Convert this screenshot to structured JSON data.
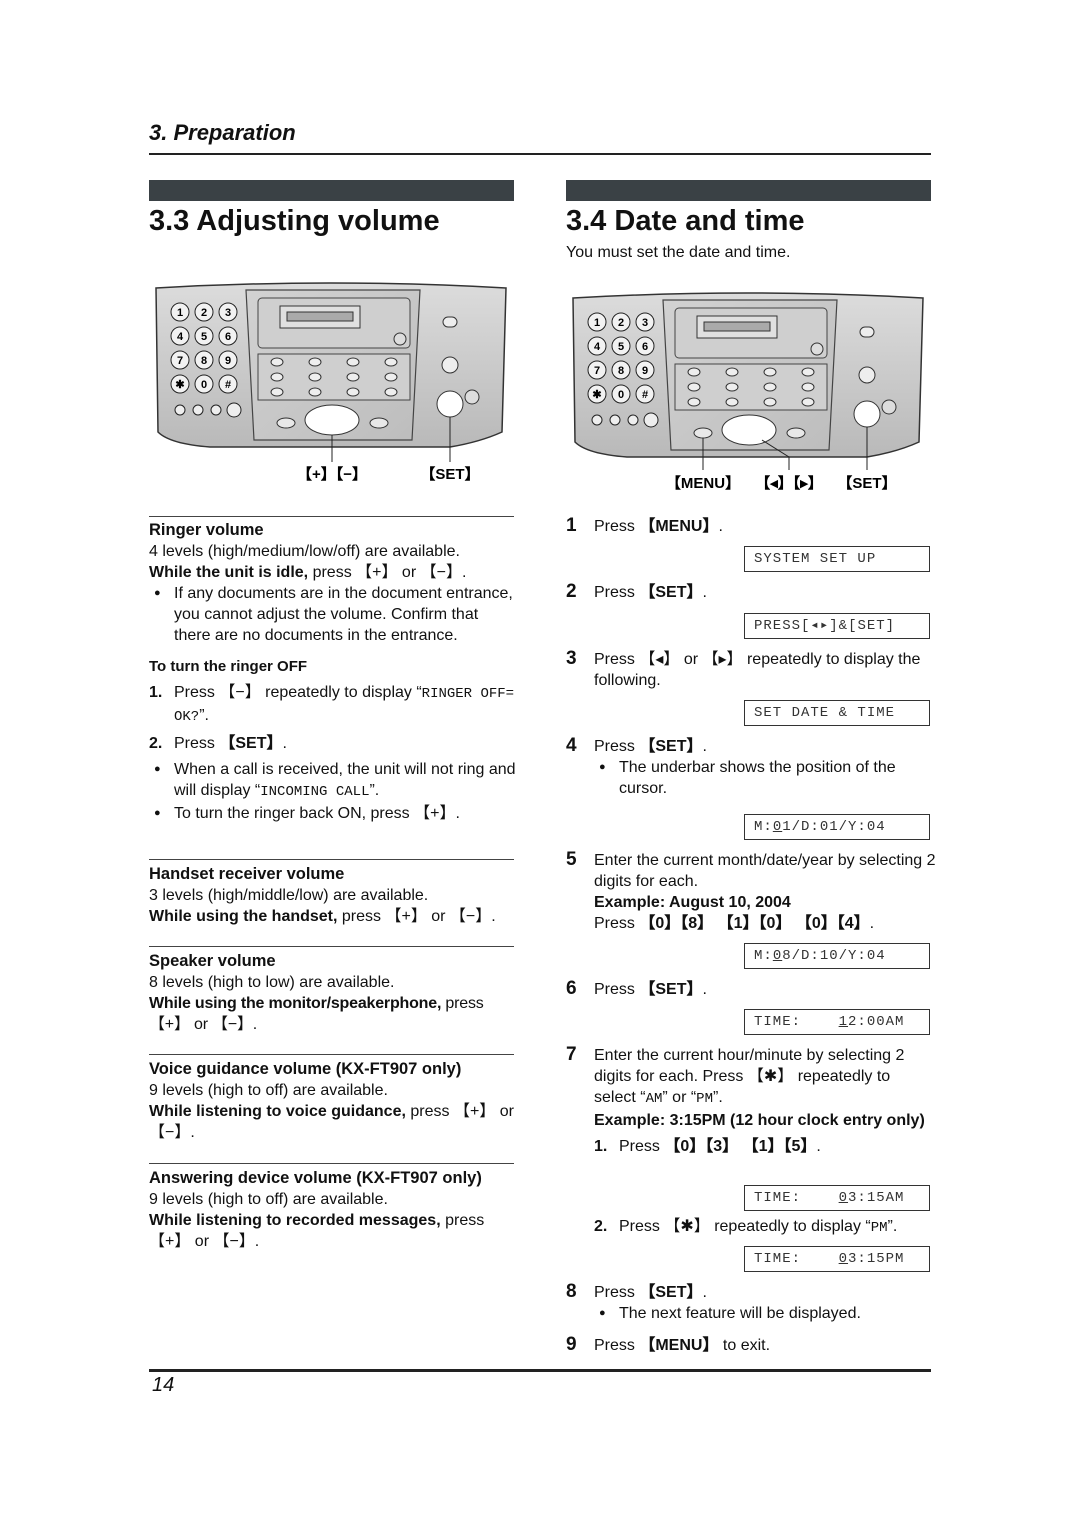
{
  "header": {
    "chapter": "3. Preparation"
  },
  "left": {
    "title": "3.3 Adjusting volume",
    "callouts": {
      "plus_minus": "【+】【−】",
      "set": "【SET】"
    },
    "keypad": [
      "1",
      "2",
      "3",
      "4",
      "5",
      "6",
      "7",
      "8",
      "9",
      "✱",
      "0",
      "#"
    ],
    "ringer": {
      "heading": "Ringer volume",
      "levels": "4 levels (high/medium/low/off) are available.",
      "instr_bold": "While the unit is idle,",
      "instr_rest": " press 【+】 or 【−】.",
      "bullet": "If any documents are in the document entrance, you cannot adjust the volume. Confirm that there are no documents in the entrance.",
      "off_heading": "To turn the ringer OFF",
      "off_step1_pre": "Press 【−】 repeatedly to display “",
      "off_step1_mono": "RINGER OFF= OK?",
      "off_step1_post": "”.",
      "off_step2_pre": "Press ",
      "off_step2_key": "【SET】",
      "off_step2_post": ".",
      "off_bullet1_pre": "When a call is received, the unit will not ring and will display “",
      "off_bullet1_mono": "INCOMING CALL",
      "off_bullet1_post": "”.",
      "off_bullet2": "To turn the ringer back ON, press 【+】."
    },
    "handset": {
      "heading": "Handset receiver volume",
      "levels": "3 levels (high/middle/low) are available.",
      "instr_bold": "While using the handset,",
      "instr_rest": " press 【+】 or 【−】."
    },
    "speaker": {
      "heading": "Speaker volume",
      "levels": "8 levels (high to low) are available.",
      "instr_bold": "While using the monitor/speakerphone,",
      "instr_rest": " press 【+】 or 【−】."
    },
    "voice": {
      "heading": "Voice guidance volume (KX-FT907 only)",
      "levels": "9 levels (high to off) are available.",
      "instr_bold": "While listening to voice guidance,",
      "instr_rest": " press 【+】 or 【−】."
    },
    "answering": {
      "heading": "Answering device volume (KX-FT907 only)",
      "levels": "9 levels (high to off) are available.",
      "instr_bold": "While listening to recorded messages,",
      "instr_rest": " press 【+】 or 【−】."
    }
  },
  "right": {
    "title": "3.4 Date and time",
    "intro": "You must set the date and time.",
    "callouts": {
      "menu": "【MENU】",
      "arrows": "【◂】【▸】",
      "set": "【SET】"
    },
    "steps": [
      {
        "n": "1",
        "pre": "Press ",
        "key": "【MENU】",
        "post": ".",
        "lcd": "SYSTEM SET UP"
      },
      {
        "n": "2",
        "pre": "Press ",
        "key": "【SET】",
        "post": ".",
        "lcd": "PRESS[◂▸]&[SET]"
      },
      {
        "n": "3",
        "text": "Press 【◂】 or 【▸】 repeatedly to display the following.",
        "lcd": "SET DATE & TIME"
      },
      {
        "n": "4",
        "pre": "Press ",
        "key": "【SET】",
        "post": ".",
        "bullet": "The underbar shows the position of the cursor.",
        "lcd_a": "M:",
        "lcd_u": "0",
        "lcd_b": "1/D:01/Y:04"
      },
      {
        "n": "5",
        "text": "Enter the current month/date/year by selecting 2 digits for each.",
        "example": "Example: August 10, 2004",
        "press_pre": "Press ",
        "press_keys": "【0】【8】 【1】【0】 【0】【4】",
        "press_post": ".",
        "lcd_a": "M:",
        "lcd_u": "0",
        "lcd_b": "8/D:10/Y:04"
      },
      {
        "n": "6",
        "pre": "Press ",
        "key": "【SET】",
        "post": ".",
        "lcd_a": "TIME:    ",
        "lcd_u": "1",
        "lcd_b": "2:00AM"
      },
      {
        "n": "7",
        "text_pre": "Enter the current hour/minute by selecting 2 digits for each. Press 【✱】 repeatedly to select “",
        "am": "AM",
        "mid": "” or “",
        "pm": "PM",
        "text_post": "”.",
        "example": "Example: 3:15PM (12 hour clock entry only)",
        "sub1_pre": "Press ",
        "sub1_keys": "【0】【3】 【1】【5】",
        "sub1_post": ".",
        "lcd1_a": "TIME:    ",
        "lcd1_u": "0",
        "lcd1_b": "3:15AM",
        "sub2_pre": "Press 【✱】 repeatedly to display “",
        "sub2_mono": "PM",
        "sub2_post": "”.",
        "lcd2_a": "TIME:    ",
        "lcd2_u": "0",
        "lcd2_b": "3:15PM"
      },
      {
        "n": "8",
        "pre": "Press ",
        "key": "【SET】",
        "post": ".",
        "bullet": "The next feature will be displayed."
      },
      {
        "n": "9",
        "pre": "Press ",
        "key": "【MENU】",
        "post": " to exit."
      }
    ]
  },
  "footer": {
    "page": "14"
  }
}
